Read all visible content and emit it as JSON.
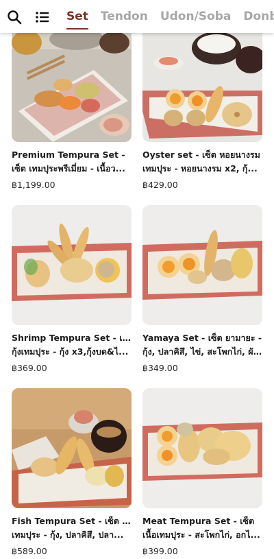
{
  "nav": {
    "search_icon": "search-icon",
    "menu_icon": "list-menu-icon",
    "tabs": [
      {
        "label": "Set",
        "active": true
      },
      {
        "label": "Tendon",
        "active": false
      },
      {
        "label": "Udon/Soba",
        "active": false
      },
      {
        "label": "Donburi",
        "active": false
      }
    ]
  },
  "products": [
    {
      "title_line1": "Premium Tempura Set -",
      "title_line2": "เซ็ต เทมปุระพรีเมี่ยม - เนื้อว...",
      "price": "฿1,199.00"
    },
    {
      "title_line1": "Oyster set - เซ็ต หอยนางรม",
      "title_line2": "เทมปุระ - หอยนางรม x2, กุ้...",
      "price": "฿429.00"
    },
    {
      "title_line1": "Shrimp Tempura Set - เซ็ต",
      "title_line2": "กุ้งเทมปุระ - กุ้ง x3,กุ้งบด&ไ...",
      "price": "฿369.00"
    },
    {
      "title_line1": "Yamaya Set - เซ็ต ยามายะ -",
      "title_line2": "กุ้ง, ปลาคิสึ, ไข่, สะโพกไก่, ผั...",
      "price": "฿349.00"
    },
    {
      "title_line1": "Fish Tempura Set - เซ็ต ปลา",
      "title_line2": "เทมปุระ - กุ้ง, ปลาคิสึ, ปลา...",
      "price": "฿589.00"
    },
    {
      "title_line1": "Meat Tempura Set - เซ็ต",
      "title_line2": "เนื้อเทมปุระ - สะโพกไก่, อกไ...",
      "price": "฿399.00"
    }
  ]
}
